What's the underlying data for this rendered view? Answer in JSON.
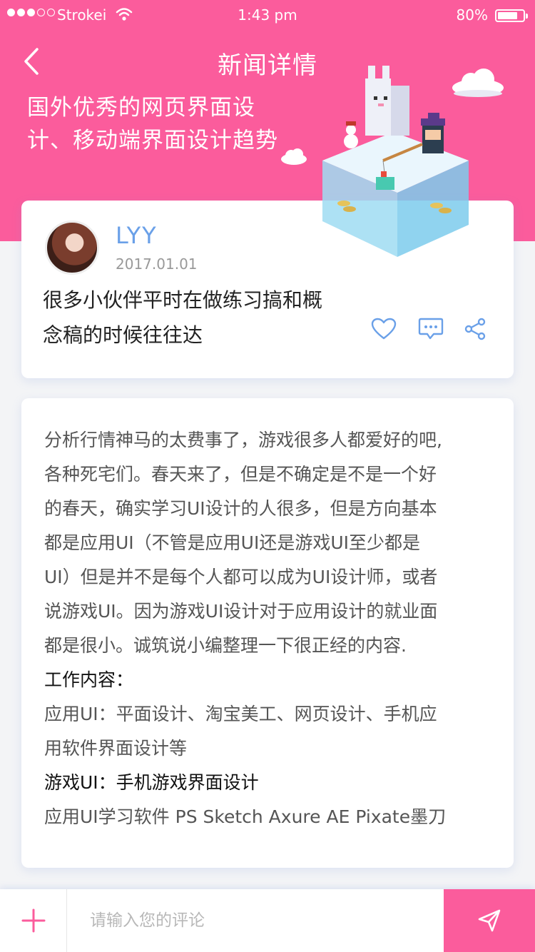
{
  "status_bar": {
    "carrier": "Strokei",
    "time": "1:43 pm",
    "battery": "80%",
    "battery_level": 0.8,
    "signal_bars_filled": 3,
    "signal_bars_total": 5
  },
  "nav": {
    "title": "新闻详情",
    "back_icon": "chevron-left-icon"
  },
  "header": {
    "headline_line1": "国外优秀的网页界面设",
    "headline_line2": "计、移动端界面设计趋势"
  },
  "post": {
    "author": "LYY",
    "date": "2017.01.01",
    "summary_line1": "很多小伙伴平时在做练习搞和概",
    "summary_line2": "念稿的时候往往达",
    "actions": [
      "heart-icon",
      "comment-icon",
      "share-icon"
    ]
  },
  "article": {
    "lines": [
      "分析行情神马的太费事了，游戏很多人都爱好的吧,",
      "各种死宅们。春天来了，但是不确定是不是一个好",
      "的春天，确实学习UI设计的人很多，但是方向基本",
      "都是应用UI（不管是应用UI还是游戏UI至少都是",
      "UI）但是并不是每个人都可以成为UI设计师，或者",
      "说游戏UI。因为游戏UI设计对于应用设计的就业面",
      "都是很小。诚筑说小编整理一下很正经的内容."
    ],
    "work_title": "工作内容：",
    "app_ui_line1": "应用UI：平面设计、淘宝美工、网页设计、手机应",
    "app_ui_line2": "用软件界面设计等",
    "game_ui_title": "游戏UI：手机游戏界面设计",
    "software_line": "应用UI学习软件 PS Sketch Axure AE Pixate墨刀"
  },
  "comment_bar": {
    "placeholder": "请输入您的评论",
    "add_icon": "plus-icon",
    "send_icon": "send-icon"
  },
  "colors": {
    "accent": "#fb5c9c",
    "author": "#6aa0e8",
    "icon_blue": "#6aa0e8"
  }
}
